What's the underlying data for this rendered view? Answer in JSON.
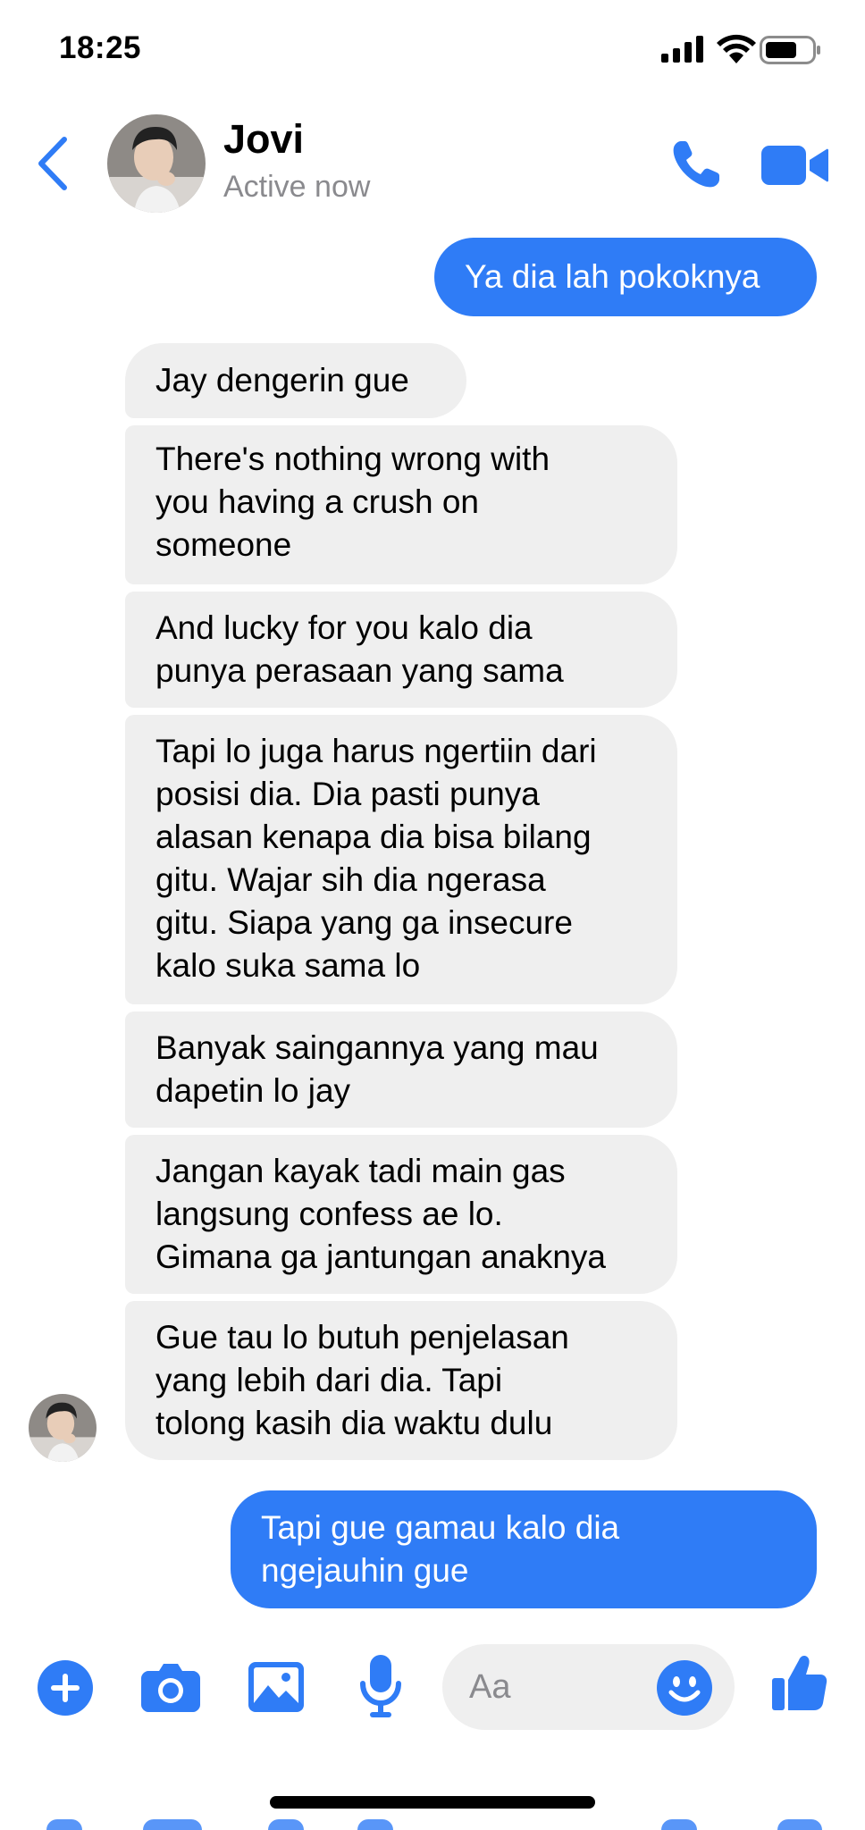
{
  "status_bar": {
    "time": "18:25"
  },
  "header": {
    "contact_name": "Jovi",
    "contact_status": "Active now"
  },
  "messages": [
    {
      "direction": "outgoing",
      "lines": [
        "Ya dia lah pokoknya"
      ]
    },
    {
      "direction": "incoming",
      "lines": [
        "Jay dengerin gue"
      ]
    },
    {
      "direction": "incoming",
      "lines": [
        "There's nothing wrong with",
        "you having a crush on",
        "someone"
      ]
    },
    {
      "direction": "incoming",
      "lines": [
        "And lucky for you kalo dia",
        "punya perasaan yang sama"
      ]
    },
    {
      "direction": "incoming",
      "lines": [
        "Tapi lo juga harus ngertiin dari",
        "posisi dia. Dia pasti punya",
        "alasan kenapa dia bisa bilang",
        "gitu. Wajar sih dia ngerasa",
        "gitu. Siapa yang ga insecure",
        "kalo suka sama lo"
      ]
    },
    {
      "direction": "incoming",
      "lines": [
        "Banyak saingannya yang mau",
        "dapetin lo jay"
      ]
    },
    {
      "direction": "incoming",
      "lines": [
        "Jangan kayak tadi main gas",
        "langsung confess ae lo.",
        "Gimana ga jantungan anaknya"
      ]
    },
    {
      "direction": "incoming",
      "lines": [
        "Gue tau lo butuh penjelasan",
        "yang lebih dari dia. Tapi",
        "tolong kasih dia waktu dulu"
      ]
    },
    {
      "direction": "outgoing",
      "lines": [
        "Tapi gue gamau kalo dia",
        "ngejauhin gue"
      ]
    }
  ],
  "composer": {
    "placeholder": "Aa"
  },
  "icons": {
    "back": "chevron-left-icon",
    "call": "phone-icon",
    "video": "video-camera-icon",
    "add": "plus-circle-icon",
    "camera": "camera-icon",
    "gallery": "image-icon",
    "mic": "microphone-icon",
    "emoji": "smiley-icon",
    "like": "thumbs-up-icon"
  },
  "colors": {
    "accent": "#2f7cf6",
    "incoming_bubble": "#efefef",
    "secondary_text": "#8a8a8e"
  }
}
